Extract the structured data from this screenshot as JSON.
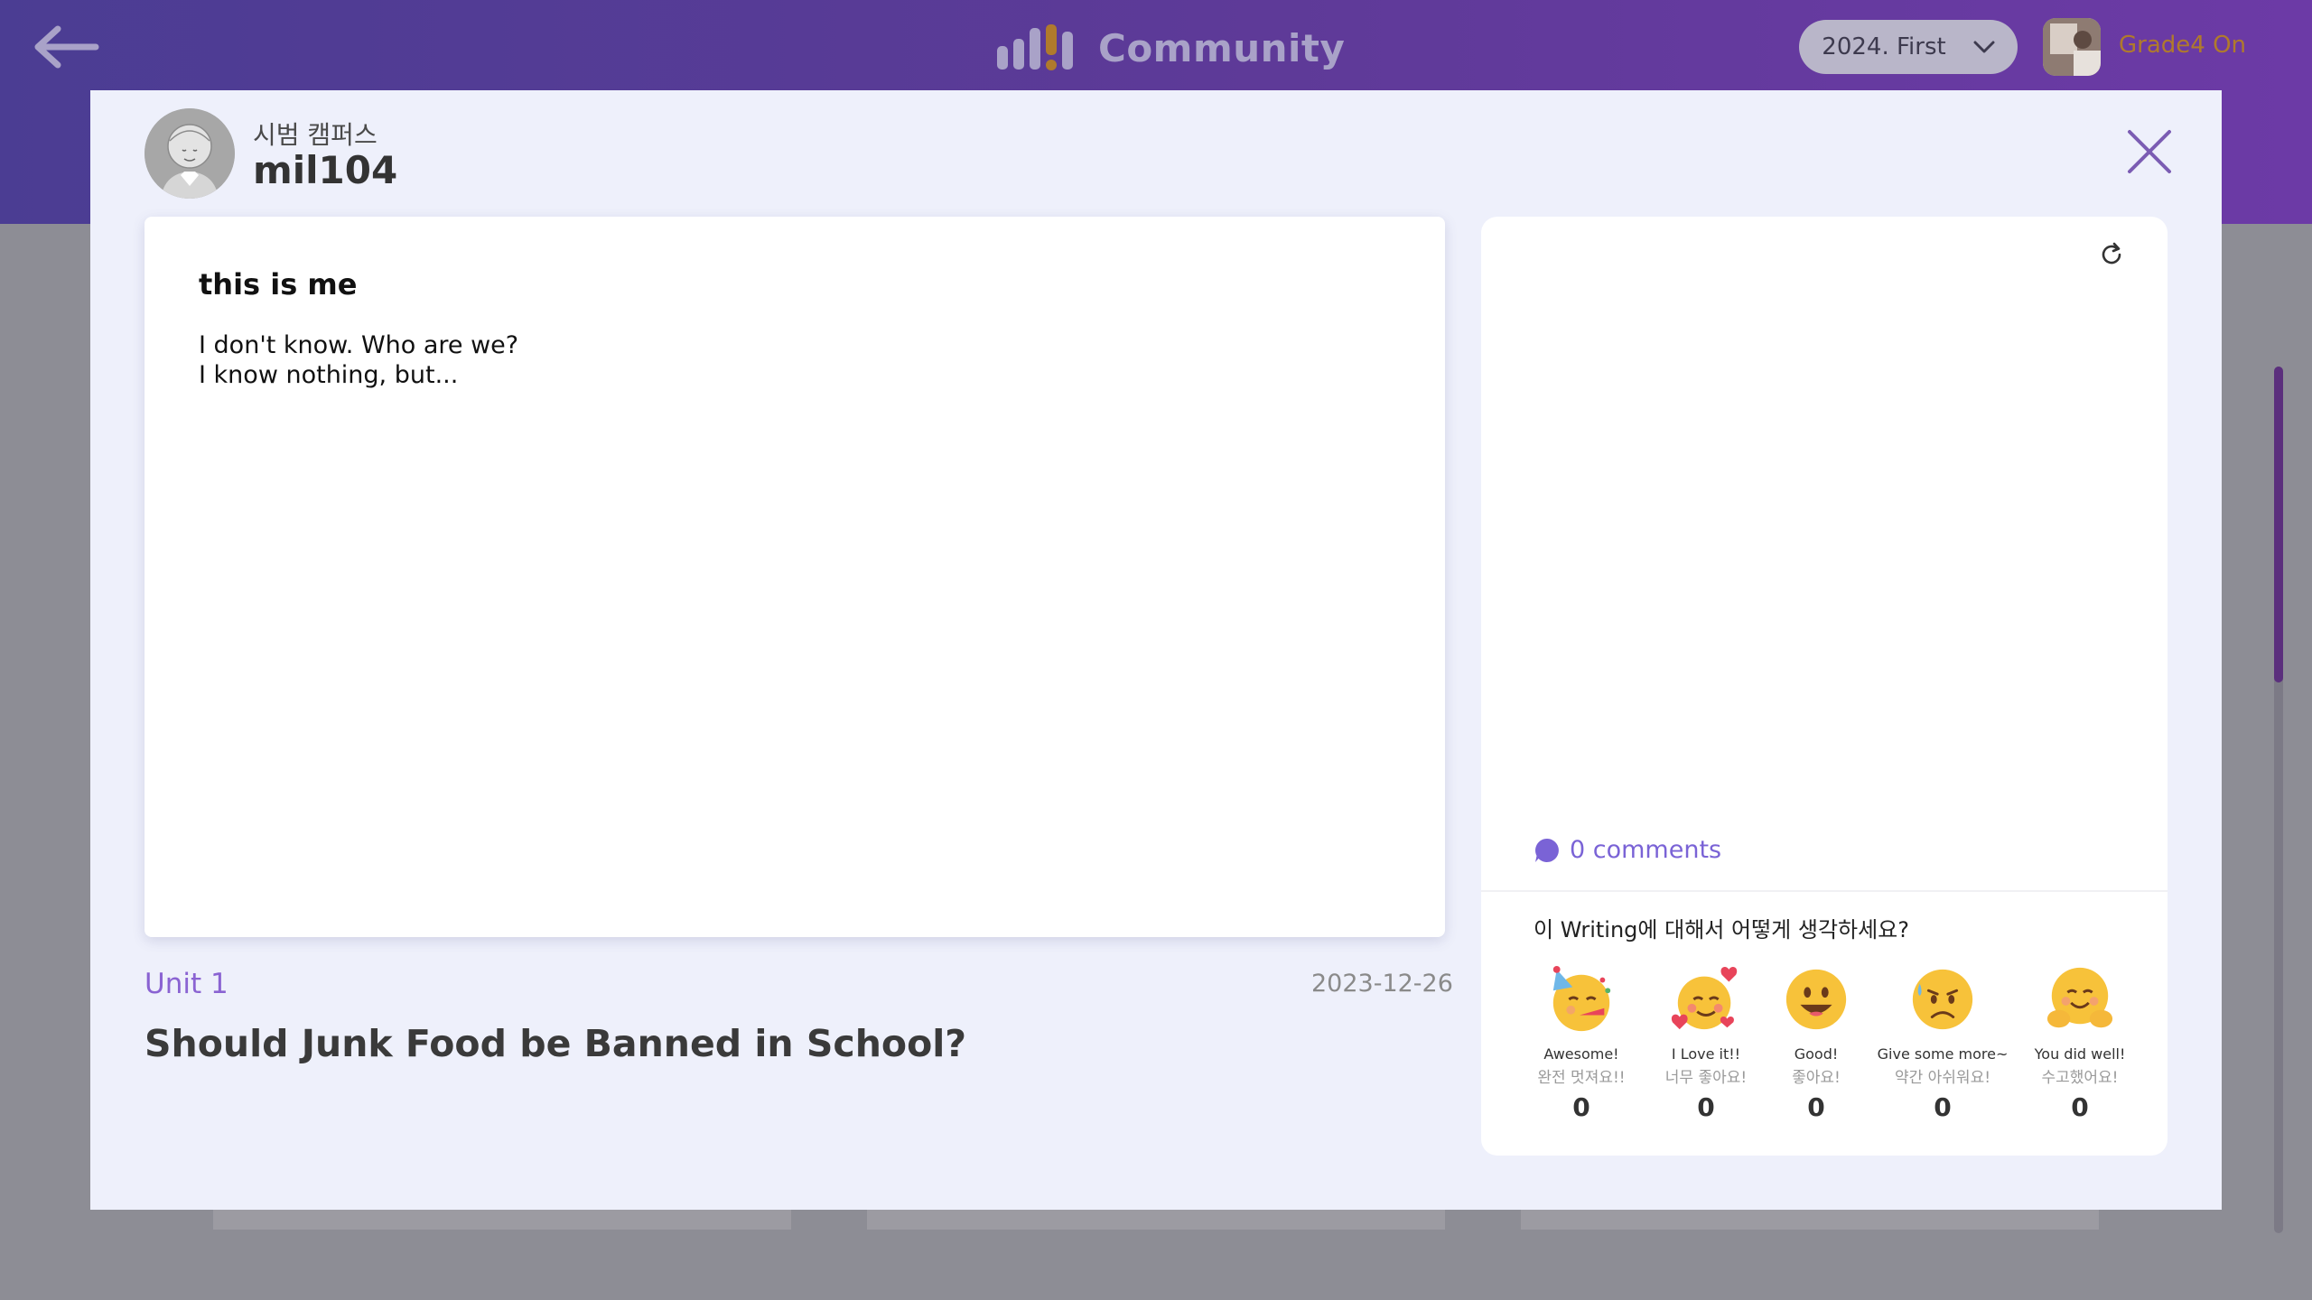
{
  "app": {
    "title": "Community",
    "term": "2024. First",
    "user_name": "Grade4 On",
    "icons": {
      "back": "arrow-left-icon",
      "brand": "bar-chart-logo-icon",
      "term_dropdown": "chevron-down-icon",
      "close": "close-icon",
      "refresh": "refresh-icon",
      "comment": "chat-bubble-icon"
    },
    "colors": {
      "header_start": "#4b3d93",
      "header_end": "#6c3aa6",
      "accent": "#8a63d2",
      "user_name": "#b07a2c"
    }
  },
  "post": {
    "author_campus": "시범 캠퍼스",
    "author_id": "mil104",
    "writing_title": "this is me",
    "writing_body_lines": [
      "I don't know. Who are we?",
      "I know nothing, but..."
    ],
    "unit": "Unit 1",
    "date": "2023-12-26",
    "topic": "Should Junk Food be Banned in School?"
  },
  "feedback": {
    "comments_label": "0 comments",
    "question": "이 Writing에 대해서 어떻게 생각하세요?",
    "reactions": [
      {
        "en": "Awesome!",
        "ko": "완전 멋져요!!",
        "count": "0",
        "icon": "party-face-icon"
      },
      {
        "en": "I Love it!!",
        "ko": "너무 좋아요!",
        "count": "0",
        "icon": "hearts-face-icon"
      },
      {
        "en": "Good!",
        "ko": "좋아요!",
        "count": "0",
        "icon": "grinning-face-icon"
      },
      {
        "en": "Give some more~",
        "ko": "약간 아쉬워요!",
        "count": "0",
        "icon": "sad-sweat-face-icon"
      },
      {
        "en": "You did well!",
        "ko": "수고했어요!",
        "count": "0",
        "icon": "hugging-face-icon"
      }
    ]
  }
}
